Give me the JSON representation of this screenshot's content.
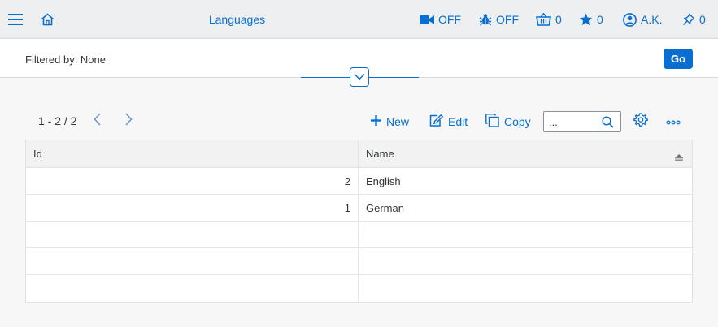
{
  "shell": {
    "title": "Languages",
    "video": "OFF",
    "debug": "OFF",
    "cart": "0",
    "favorites": "0",
    "user": "A.K.",
    "pins": "0"
  },
  "filter": {
    "text": "Filtered by: None",
    "go_label": "Go"
  },
  "toolbar": {
    "pager": "1 - 2 / 2",
    "new_label": "New",
    "edit_label": "Edit",
    "copy_label": "Copy",
    "search_placeholder": "..."
  },
  "table": {
    "columns": [
      "Id",
      "Name"
    ],
    "rows": [
      {
        "id": "2",
        "name": "English"
      },
      {
        "id": "1",
        "name": "German"
      },
      {
        "id": "",
        "name": ""
      },
      {
        "id": "",
        "name": ""
      },
      {
        "id": "",
        "name": ""
      }
    ]
  },
  "colors": {
    "accent": "#0a6ed1",
    "shell_bg": "#edeff0",
    "page_bg": "#f7f7f7"
  }
}
